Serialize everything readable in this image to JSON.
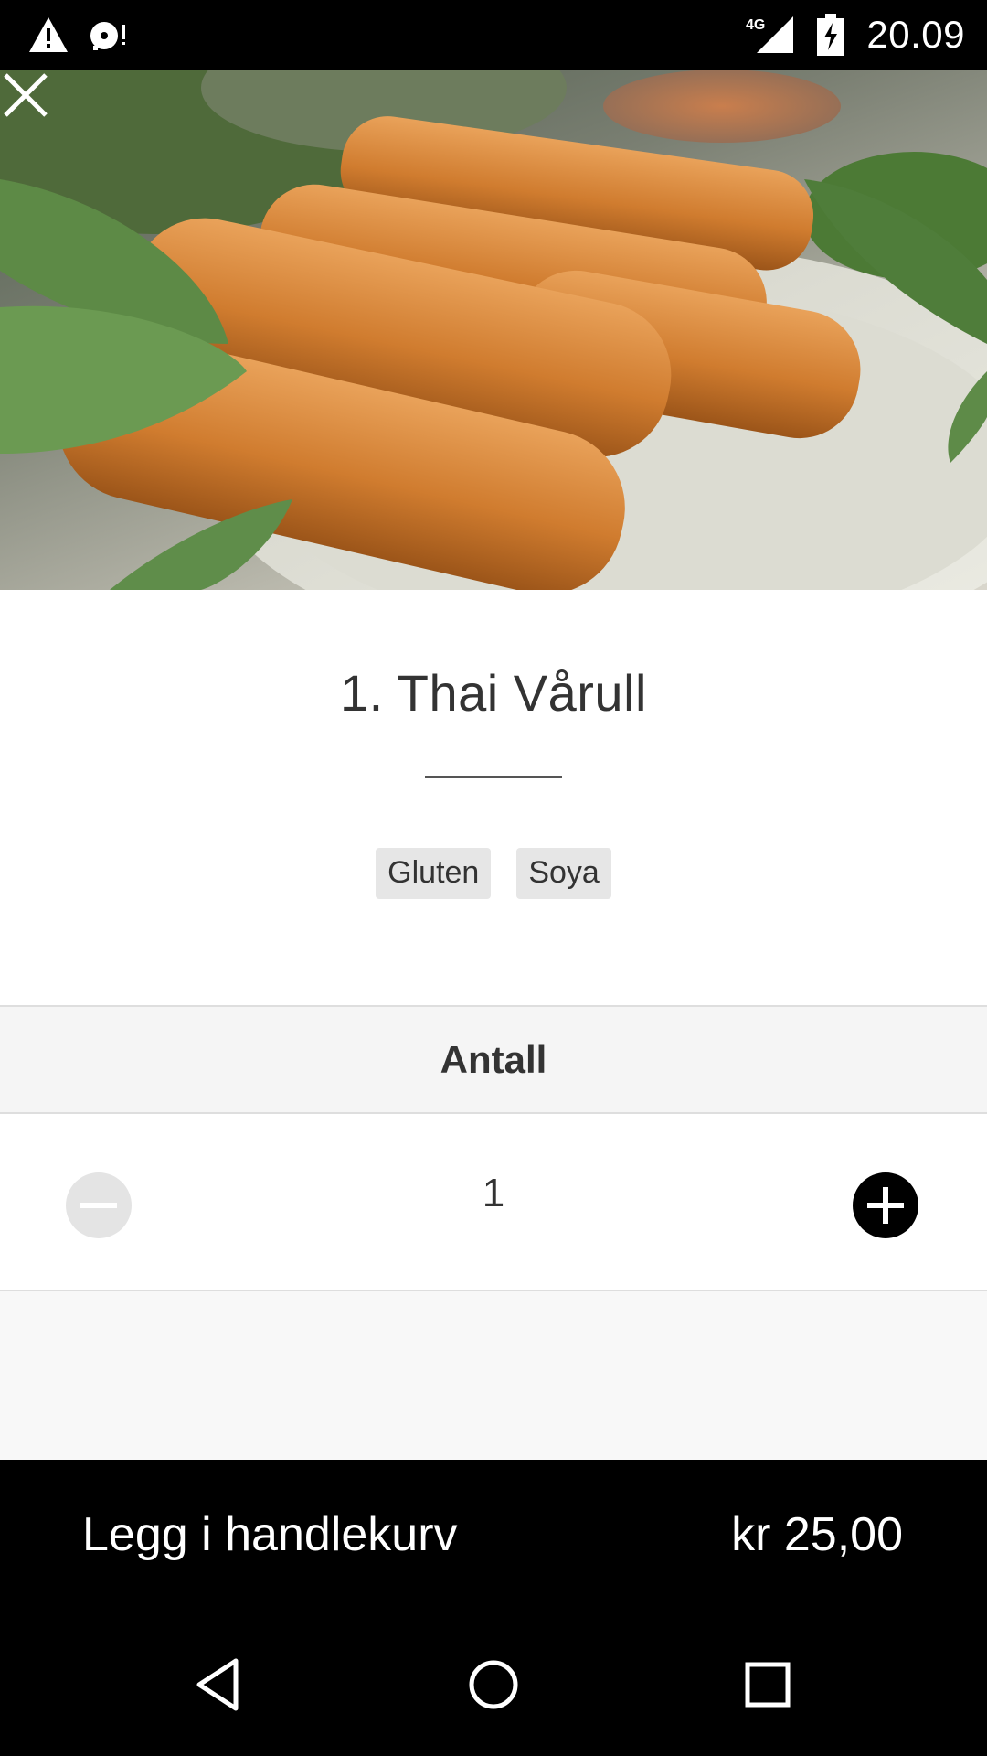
{
  "status_bar": {
    "time": "20.09",
    "network": "4G",
    "left_icons": [
      "warning-icon",
      "disc-alert-icon"
    ],
    "right_icons": [
      "signal-icon",
      "battery-charging-icon"
    ]
  },
  "hero": {
    "image": "spring-rolls-photo",
    "close_icon": "close-icon"
  },
  "product": {
    "title": "1. Thai Vårull",
    "allergens": [
      "Gluten",
      "Soya"
    ]
  },
  "quantity": {
    "header": "Antall",
    "value": "1",
    "decrement_icon": "minus-icon",
    "increment_icon": "plus-icon"
  },
  "cart": {
    "label": "Legg i handlekurv",
    "price": "kr 25,00"
  },
  "nav": {
    "icons": [
      "back-icon",
      "home-icon",
      "recents-icon"
    ]
  },
  "colors": {
    "status_bar_bg": "#000000",
    "cart_bar_bg": "#000000",
    "tag_bg": "#e6e6e6",
    "minus_button_bg": "#e4e4e4",
    "plus_button_bg": "#000000",
    "title_text": "#333333"
  }
}
